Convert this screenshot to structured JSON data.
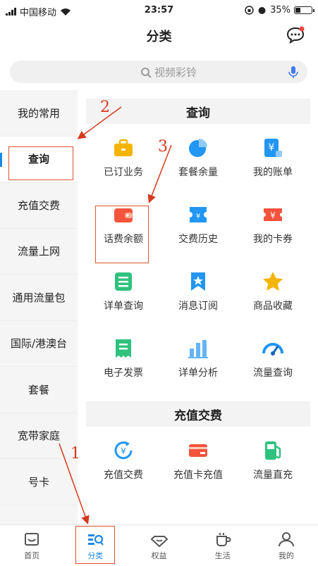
{
  "status_bar": {
    "carrier": "中国移动",
    "time": "23:57",
    "battery": "35%",
    "battery_level": 0.35
  },
  "header": {
    "title": "分类"
  },
  "search": {
    "placeholder": "视频彩铃"
  },
  "sidebar": {
    "items": [
      {
        "label": "我的常用"
      },
      {
        "label": "查询"
      },
      {
        "label": "充值交费"
      },
      {
        "label": "流量上网"
      },
      {
        "label": "通用流量包"
      },
      {
        "label": "国际/港澳台"
      },
      {
        "label": "套餐"
      },
      {
        "label": "宽带家庭"
      },
      {
        "label": "号卡"
      }
    ],
    "active_index": 1
  },
  "sections": [
    {
      "title": "查询",
      "items": [
        {
          "label": "已订业务",
          "icon": "briefcase-icon",
          "color": "#f5b400"
        },
        {
          "label": "套餐余量",
          "icon": "pie-chart-icon",
          "color": "#2196f3"
        },
        {
          "label": "我的账单",
          "icon": "bill-icon",
          "color": "#2196f3"
        },
        {
          "label": "话费余额",
          "icon": "wallet-icon",
          "color": "#f4533c"
        },
        {
          "label": "交费历史",
          "icon": "ticket-icon",
          "color": "#2196f3"
        },
        {
          "label": "我的卡券",
          "icon": "coupon-icon",
          "color": "#f4533c"
        },
        {
          "label": "详单查询",
          "icon": "list-icon",
          "color": "#2ec27e"
        },
        {
          "label": "消息订阅",
          "icon": "bookmark-icon",
          "color": "#2196f3"
        },
        {
          "label": "商品收藏",
          "icon": "star-icon",
          "color": "#f5b400"
        },
        {
          "label": "电子发票",
          "icon": "invoice-icon",
          "color": "#2ec27e"
        },
        {
          "label": "详单分析",
          "icon": "bar-chart-icon",
          "color": "#64b5f6"
        },
        {
          "label": "流量查询",
          "icon": "gauge-icon",
          "color": "#2196f3"
        }
      ]
    },
    {
      "title": "充值交费",
      "items": [
        {
          "label": "充值交费",
          "icon": "recharge-icon",
          "color": "#2196f3"
        },
        {
          "label": "充值卡充值",
          "icon": "card-icon",
          "color": "#f4533c"
        },
        {
          "label": "流量直充",
          "icon": "fuel-icon",
          "color": "#2ec27e"
        }
      ]
    }
  ],
  "tabbar": {
    "items": [
      {
        "label": "首页",
        "icon": "home-icon"
      },
      {
        "label": "分类",
        "icon": "category-icon"
      },
      {
        "label": "权益",
        "icon": "diamond-icon"
      },
      {
        "label": "生活",
        "icon": "cup-icon"
      },
      {
        "label": "我的",
        "icon": "person-icon"
      }
    ],
    "active_index": 1
  },
  "annotations": {
    "one": "1",
    "two": "2",
    "three": "3"
  },
  "colors": {
    "accent": "#1e88e5",
    "annotation": "#d63a1d"
  }
}
